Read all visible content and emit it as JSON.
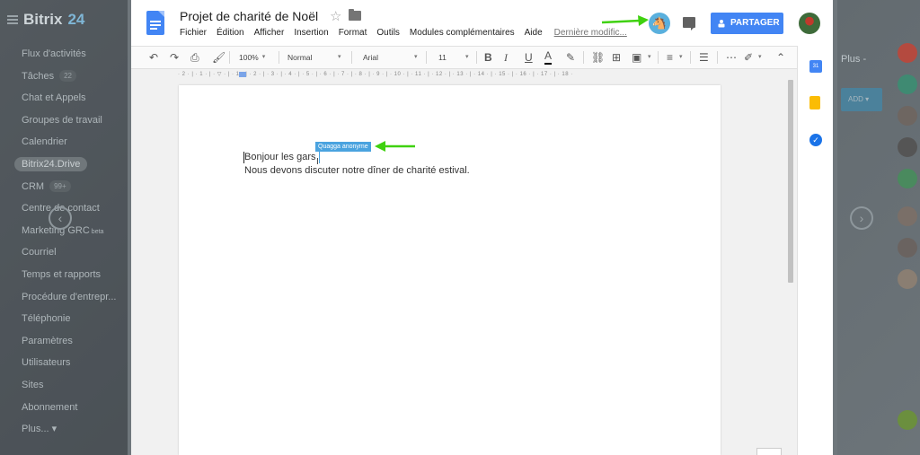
{
  "background_app": {
    "logo": "Bitrix",
    "logo_number": "24",
    "menu": [
      {
        "label": "Flux d'activités"
      },
      {
        "label": "Tâches",
        "count": "22"
      },
      {
        "label": "Chat et Appels"
      },
      {
        "label": "Groupes de travail"
      },
      {
        "label": "Calendrier"
      },
      {
        "label": "Bitrix24.Drive",
        "active": true
      },
      {
        "label": "CRM",
        "count": "99+"
      },
      {
        "label": "Centre de contact"
      },
      {
        "label": "Marketing GRC",
        "badge": "beta"
      },
      {
        "label": "Courriel"
      },
      {
        "label": "Temps et rapports"
      },
      {
        "label": "Procédure d'entrepr..."
      },
      {
        "label": "Téléphonie"
      },
      {
        "label": "Paramètres"
      },
      {
        "label": "Utilisateurs"
      },
      {
        "label": "Sites"
      },
      {
        "label": "Abonnement"
      },
      {
        "label": "Plus... ▾"
      }
    ],
    "right_plus": "Plus -",
    "right_add": "ADD ▾"
  },
  "document": {
    "title": "Projet de charité de Noël",
    "menu": [
      "Fichier",
      "Édition",
      "Afficher",
      "Insertion",
      "Format",
      "Outils",
      "Modules complémentaires",
      "Aide"
    ],
    "last_edit": "Dernière modific...",
    "share_label": "PARTAGER",
    "toolbar": {
      "zoom": "100%",
      "style": "Normal",
      "font": "Arial",
      "size": "11"
    },
    "ruler_text": "· 2 · | · 1 · | · ▽ · | · 1 · | · 2 · | · 3 · | · 4 · | · 5 · | · 6 · | · 7 · | · 8 · | · 9 · | · 10 · | · 11 · | · 12 · | · 13 · | · 14 · | · 15 · | · 16 · | · 17 · | · 18 ·",
    "lines": [
      "Bonjour les gars",
      "Nous devons discuter notre dîner de charité estival."
    ],
    "collaborator_label": "Quagga anonyme"
  },
  "sidepanel": {
    "calendar_day": "31",
    "tasks_mark": "✓"
  },
  "colors": {
    "accent": "#4285f4",
    "annotation": "#3fd10f",
    "collab": "#4aa3df"
  },
  "icons": [
    "undo-icon",
    "redo-icon",
    "print-icon",
    "paint-format-icon",
    "bold-icon",
    "italic-icon",
    "underline-icon",
    "text-color-icon",
    "highlight-icon",
    "link-icon",
    "comment-add-icon",
    "image-icon",
    "align-icon",
    "line-spacing-icon",
    "more-icon",
    "pen-icon",
    "collapse-icon"
  ]
}
